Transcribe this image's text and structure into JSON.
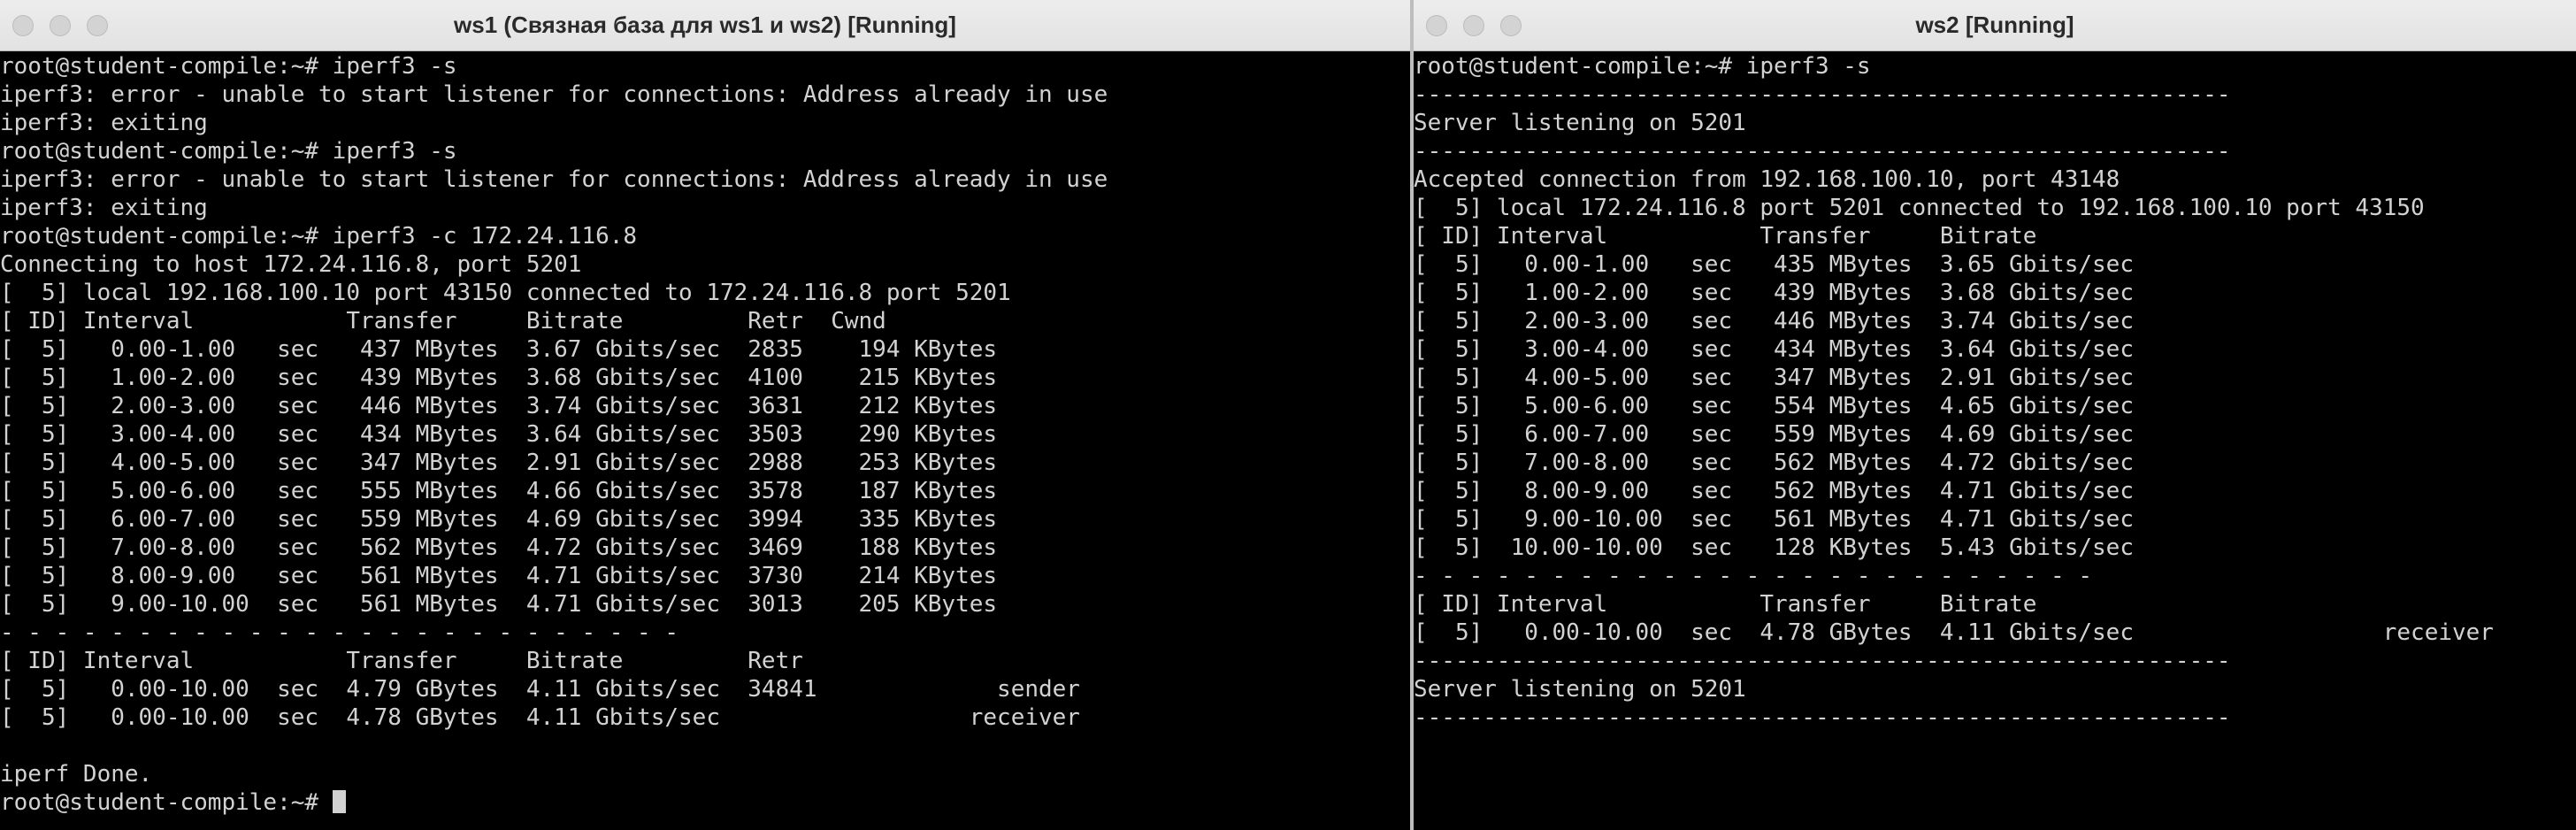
{
  "window1": {
    "title": "ws1 (Связная база для ws1 и ws2) [Running]",
    "lines": [
      "root@student-compile:~# iperf3 -s",
      "iperf3: error - unable to start listener for connections: Address already in use",
      "iperf3: exiting",
      "root@student-compile:~# iperf3 -s",
      "iperf3: error - unable to start listener for connections: Address already in use",
      "iperf3: exiting",
      "root@student-compile:~# iperf3 -c 172.24.116.8",
      "Connecting to host 172.24.116.8, port 5201",
      "[  5] local 192.168.100.10 port 43150 connected to 172.24.116.8 port 5201",
      "[ ID] Interval           Transfer     Bitrate         Retr  Cwnd",
      "[  5]   0.00-1.00   sec   437 MBytes  3.67 Gbits/sec  2835    194 KBytes",
      "[  5]   1.00-2.00   sec   439 MBytes  3.68 Gbits/sec  4100    215 KBytes",
      "[  5]   2.00-3.00   sec   446 MBytes  3.74 Gbits/sec  3631    212 KBytes",
      "[  5]   3.00-4.00   sec   434 MBytes  3.64 Gbits/sec  3503    290 KBytes",
      "[  5]   4.00-5.00   sec   347 MBytes  2.91 Gbits/sec  2988    253 KBytes",
      "[  5]   5.00-6.00   sec   555 MBytes  4.66 Gbits/sec  3578    187 KBytes",
      "[  5]   6.00-7.00   sec   559 MBytes  4.69 Gbits/sec  3994    335 KBytes",
      "[  5]   7.00-8.00   sec   562 MBytes  4.72 Gbits/sec  3469    188 KBytes",
      "[  5]   8.00-9.00   sec   561 MBytes  4.71 Gbits/sec  3730    214 KBytes",
      "[  5]   9.00-10.00  sec   561 MBytes  4.71 Gbits/sec  3013    205 KBytes",
      "- - - - - - - - - - - - - - - - - - - - - - - - -",
      "[ ID] Interval           Transfer     Bitrate         Retr",
      "[  5]   0.00-10.00  sec  4.79 GBytes  4.11 Gbits/sec  34841             sender",
      "[  5]   0.00-10.00  sec  4.78 GBytes  4.11 Gbits/sec                  receiver",
      "",
      "iperf Done.",
      "root@student-compile:~# "
    ]
  },
  "window2": {
    "title": "ws2 [Running]",
    "lines": [
      "root@student-compile:~# iperf3 -s",
      "-----------------------------------------------------------",
      "Server listening on 5201",
      "-----------------------------------------------------------",
      "Accepted connection from 192.168.100.10, port 43148",
      "[  5] local 172.24.116.8 port 5201 connected to 192.168.100.10 port 43150",
      "[ ID] Interval           Transfer     Bitrate",
      "[  5]   0.00-1.00   sec   435 MBytes  3.65 Gbits/sec",
      "[  5]   1.00-2.00   sec   439 MBytes  3.68 Gbits/sec",
      "[  5]   2.00-3.00   sec   446 MBytes  3.74 Gbits/sec",
      "[  5]   3.00-4.00   sec   434 MBytes  3.64 Gbits/sec",
      "[  5]   4.00-5.00   sec   347 MBytes  2.91 Gbits/sec",
      "[  5]   5.00-6.00   sec   554 MBytes  4.65 Gbits/sec",
      "[  5]   6.00-7.00   sec   559 MBytes  4.69 Gbits/sec",
      "[  5]   7.00-8.00   sec   562 MBytes  4.72 Gbits/sec",
      "[  5]   8.00-9.00   sec   562 MBytes  4.71 Gbits/sec",
      "[  5]   9.00-10.00  sec   561 MBytes  4.71 Gbits/sec",
      "[  5]  10.00-10.00  sec   128 KBytes  5.43 Gbits/sec",
      "- - - - - - - - - - - - - - - - - - - - - - - - -",
      "[ ID] Interval           Transfer     Bitrate",
      "[  5]   0.00-10.00  sec  4.78 GBytes  4.11 Gbits/sec                  receiver",
      "-----------------------------------------------------------",
      "Server listening on 5201",
      "-----------------------------------------------------------"
    ]
  }
}
